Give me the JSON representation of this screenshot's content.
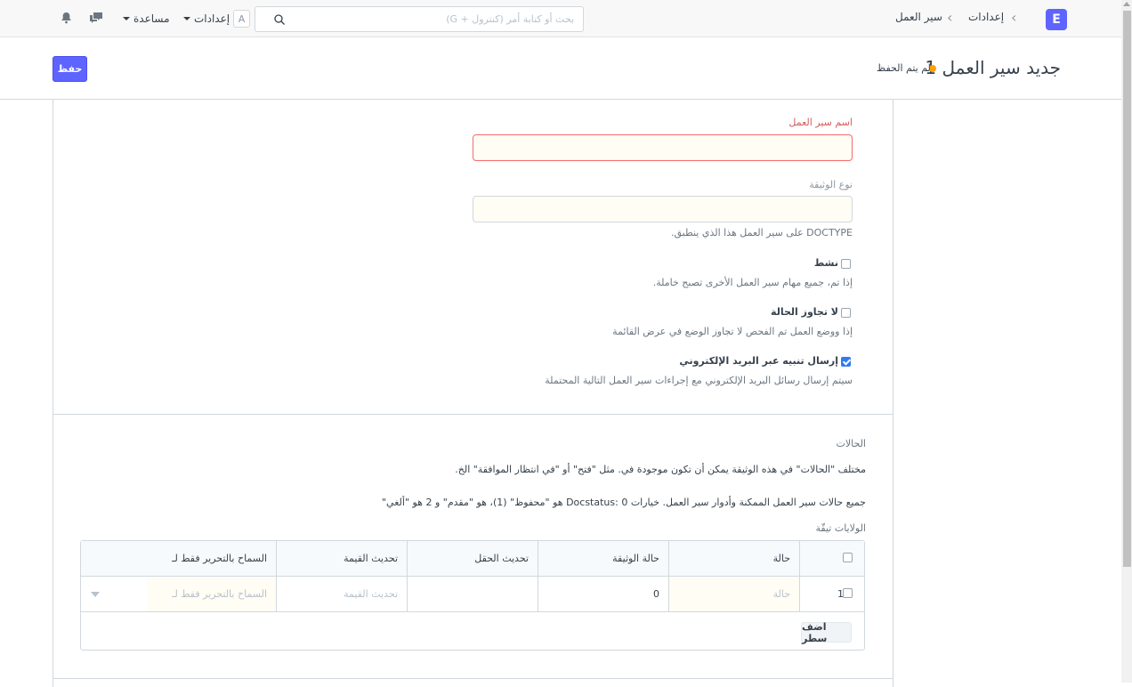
{
  "navbar": {
    "logo_letter": "E",
    "breadcrumb": [
      "إعدادات",
      "سير العمل"
    ],
    "search_placeholder": "بحث أو كتابة أمر (كنترول + G)",
    "avatar_letter": "A",
    "settings_label": "إعدادات",
    "help_label": "مساعدة"
  },
  "page": {
    "title": "جديد سير العمل 1",
    "status": "لم يتم الحفظ",
    "save_label": "حفظ",
    "indicator_color": "#ffa00a"
  },
  "form": {
    "workflow_name_label": "اسم سير العمل",
    "doctype_label": "نوع الوثيقة",
    "doctype_help": "DOCTYPE على سير العمل هذا الذي ينطبق.",
    "active_label": "نشط",
    "active_help": "إذا تم، جميع مهام سير العمل الأخرى تصبح خاملة.",
    "no_override_label": "لا تجاوز الحالة",
    "no_override_help": "إذا ووضع العمل تم الفحص لا تجاوز الوضع في عرض القائمة",
    "email_alert_label": "إرسال تنبيه عبر البريد الإلكتروني",
    "email_alert_help": "سيتم إرسال رسائل البريد الإلكتروني مع إجراءات سير العمل التالية المحتملة",
    "states_title": "الحالات",
    "states_text_1": "مختلف \"الحالات\" في هذه الوثيقة يمكن أن تكون موجودة في. مثل \"فتح\" أو \"في انتظار الموافقة\" الخ.",
    "states_text_2": "جميع حالات سير العمل الممكنة وأدوار سير العمل. خيارات Docstatus: 0 هو \"محفوظ\" (1)، هو \"مقدم\" و 2 هو \"ألغي\"",
    "grid_label": "الولايات تيقّة"
  },
  "grid": {
    "headers": [
      "حالة",
      "حالة الوثيقة",
      "تحديث الحقل",
      "تحديث القيمة",
      "السماح بالتحرير فقط لـ"
    ],
    "row": {
      "index": "1",
      "state_placeholder": "حالة",
      "doc_status": "0",
      "update_value_placeholder": "تحديث القيمة",
      "allow_edit_placeholder": "السماح بالتحرير فقط لـ"
    },
    "add_row_label": "اضف سطر"
  }
}
